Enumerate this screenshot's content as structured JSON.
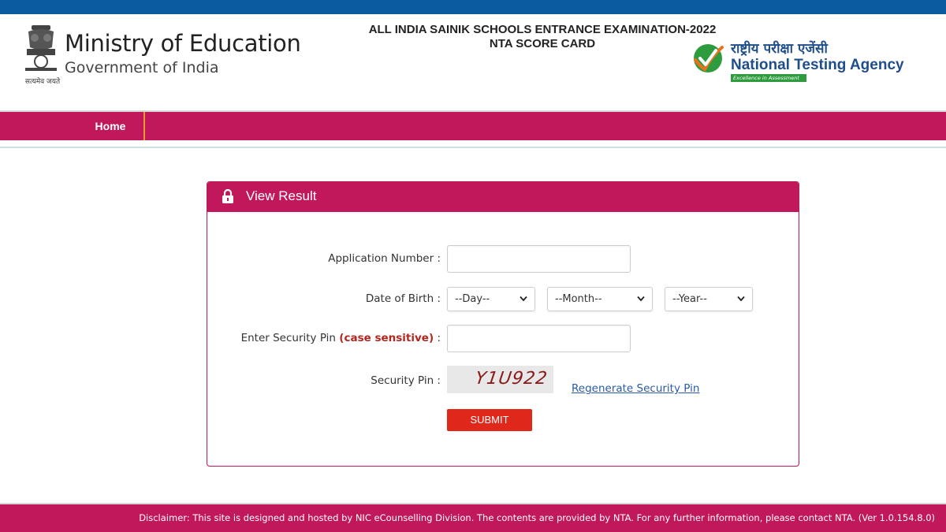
{
  "header": {
    "ministry_title": "Ministry of Education",
    "ministry_subtitle": "Government of India",
    "emblem_motto": "सत्यमेव जयते",
    "exam_title": "ALL INDIA SAINIK SCHOOLS ENTRANCE EXAMINATION-2022",
    "exam_subtitle": "NTA SCORE CARD",
    "nta_hindi": "राष्ट्रीय परीक्षा एजेंसी",
    "nta_english": "National Testing Agency",
    "nta_tagline": "Excellence in Assessment"
  },
  "nav": {
    "home_label": "Home"
  },
  "panel": {
    "title": "View Result",
    "application_number_label": "Application Number :",
    "application_number_value": "",
    "dob_label": "Date of Birth :",
    "day_selected": "--Day--",
    "month_selected": "--Month--",
    "year_selected": "--Year--",
    "security_pin_label_main": "Enter Security Pin",
    "security_pin_label_em": "(case sensitive)",
    "security_pin_label_end": ":",
    "security_pin_value": "",
    "captcha_label": "Security Pin :",
    "captcha_text": "Y1U922",
    "regenerate_label": "Regenerate Security Pin",
    "submit_label": "SUBMIT"
  },
  "footer": {
    "disclaimer": "Disclaimer: This site is designed and hosted by NIC eCounselling Division. The contents are provided by NTA. For any further information, please contact NTA. (Ver 1.0.154.8.0)"
  },
  "colors": {
    "top_strip": "#0b5c9e",
    "brand_magenta": "#c0185a",
    "submit_red": "#e0281a",
    "link_blue": "#2b5aa8",
    "nav_separator": "#e59b2f"
  },
  "icons": {
    "emblem": "national-emblem-icon",
    "nta_logo": "nta-checkmark-logo-icon",
    "lock": "lock-icon",
    "dropdown": "chevron-down-icon"
  }
}
